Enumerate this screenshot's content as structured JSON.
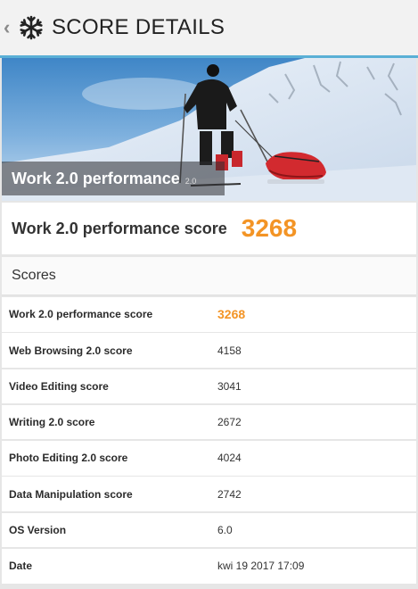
{
  "header": {
    "back_glyph": "‹",
    "title": "SCORE DETAILS",
    "logo_icon": "snowflake-icon"
  },
  "hero": {
    "title": "Work 2.0 performance",
    "version": "2.0",
    "image": "skier-pulling-red-sled-on-snowy-slope"
  },
  "score_card": {
    "label": "Work 2.0 performance score",
    "value": "3268"
  },
  "scores_section": {
    "title": "Scores"
  },
  "rows": [
    {
      "label": "Work 2.0 performance score",
      "value": "3268"
    },
    {
      "label": "Web Browsing 2.0 score",
      "value": "4158"
    },
    {
      "label": "Video Editing score",
      "value": "3041"
    },
    {
      "label": "Writing 2.0 score",
      "value": "2672"
    },
    {
      "label": "Photo Editing 2.0 score",
      "value": "4024"
    },
    {
      "label": "Data Manipulation score",
      "value": "2742"
    },
    {
      "label": "OS Version",
      "value": "6.0"
    },
    {
      "label": "Date",
      "value": "kwi 19 2017 17:09"
    }
  ],
  "colors": {
    "accent": "#f39425",
    "header_rule": "#5ab0d6",
    "background": "#e6e6e6"
  }
}
